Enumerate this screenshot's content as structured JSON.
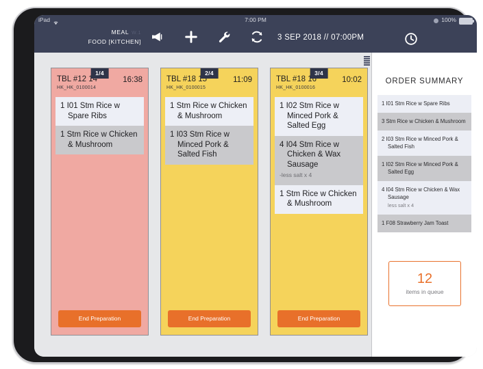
{
  "status_bar": {
    "device": "iPad",
    "wifi_icon": "wifi-icon",
    "time": "7:00 PM",
    "bluetooth_icon": "bluetooth-icon",
    "battery_percent": "100%",
    "battery_icon": "battery-full-icon"
  },
  "header": {
    "meal_label": "MEAL",
    "meal_sub": "W.1",
    "station_label": "FOOD [KITCHEN]",
    "datetime": "3 SEP 2018 // 07:00PM",
    "toolbar": [
      {
        "name": "megaphone-icon",
        "label": "Announce"
      },
      {
        "name": "plus-icon",
        "label": "Add"
      },
      {
        "name": "wrench-icon",
        "label": "Settings"
      },
      {
        "name": "refresh-icon",
        "label": "Refresh"
      }
    ],
    "clock_icon": "clock-icon"
  },
  "cards": [
    {
      "color": "red",
      "badge": "1/4",
      "table": "TBL #12 14",
      "time": "16:38",
      "ref": "HK_HK_0100014",
      "items": [
        {
          "qty": "1",
          "text": "I01 Stm Rice w Spare Ribs",
          "note": ""
        },
        {
          "qty": "1",
          "text": "Stm Rice w Chicken & Mushroom",
          "note": ""
        }
      ],
      "button": "End Preparation"
    },
    {
      "color": "yellow",
      "badge": "2/4",
      "table": "TBL #18 15",
      "time": "11:09",
      "ref": "HK_HK_0100015",
      "items": [
        {
          "qty": "1",
          "text": "Stm Rice w Chicken & Mushroom",
          "note": ""
        },
        {
          "qty": "1",
          "text": "I03 Stm Rice w Minced Pork & Salted Fish",
          "note": ""
        }
      ],
      "button": "End Preparation"
    },
    {
      "color": "yellow",
      "badge": "3/4",
      "table": "TBL #18 16",
      "time": "10:02",
      "ref": "HK_HK_0100016",
      "items": [
        {
          "qty": "1",
          "text": "I02 Stm Rice w Minced Pork & Salted Egg",
          "note": ""
        },
        {
          "qty": "4",
          "text": "I04 Stm Rice w Chicken & Wax Sausage",
          "note": "-less salt x 4"
        },
        {
          "qty": "1",
          "text": "Stm Rice w Chicken & Mushroom",
          "note": ""
        }
      ],
      "button": "End Preparation"
    }
  ],
  "summary": {
    "grip_icon": "hamburger-icon",
    "title": "ORDER SUMMARY",
    "rows": [
      {
        "qty": "1",
        "text": "I01 Stm Rice w Spare Ribs",
        "note": ""
      },
      {
        "qty": "3",
        "text": "Stm Rice w Chicken & Mushroom",
        "note": ""
      },
      {
        "qty": "2",
        "text": "I03 Stm Rice w Minced Pork & Salted Fish",
        "note": ""
      },
      {
        "qty": "1",
        "text": "I02 Stm Rice w Minced Pork & Salted Egg",
        "note": ""
      },
      {
        "qty": "4",
        "text": "I04 Stm Rice w Chicken & Wax Sausage",
        "note": "less salt x 4"
      },
      {
        "qty": "1",
        "text": "F08 Strawberry Jam Toast",
        "note": ""
      }
    ],
    "queue_count": "12",
    "queue_label": "items in queue"
  },
  "colors": {
    "header_bg": "#3c4258",
    "card_red": "#f0a9a2",
    "card_yellow": "#f5d35b",
    "accent_orange": "#e8702a",
    "badge_bg": "#2e3449"
  }
}
